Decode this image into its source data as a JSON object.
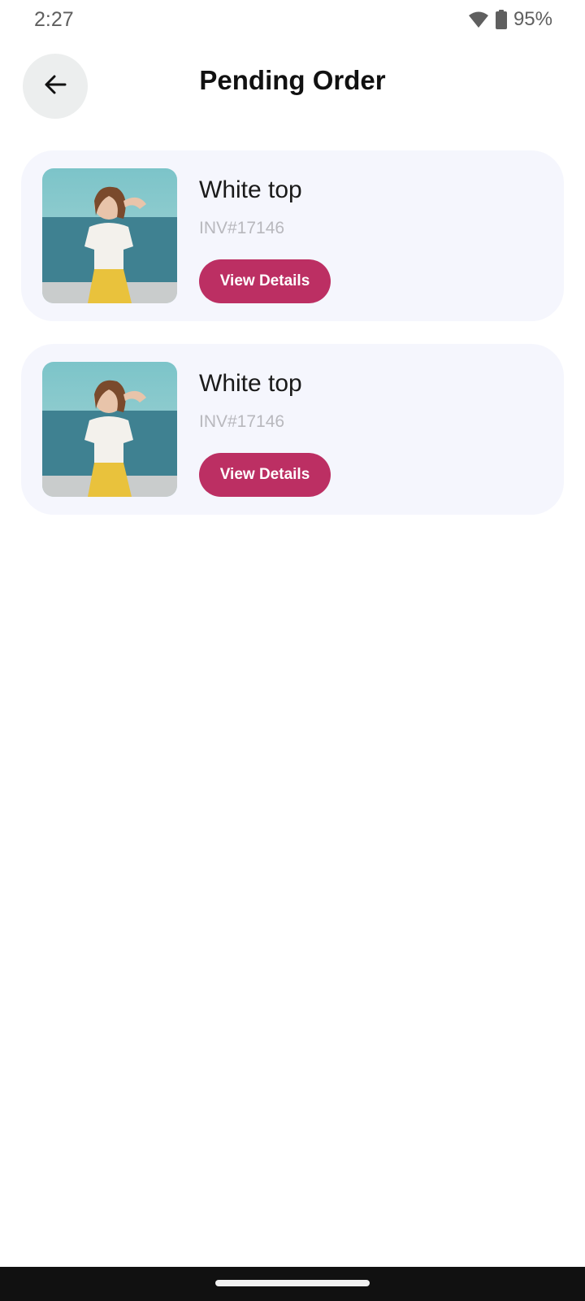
{
  "status_bar": {
    "time": "2:27",
    "battery": "95%",
    "icons": [
      "wifi-icon",
      "battery-icon"
    ]
  },
  "header": {
    "title": "Pending Order",
    "back_icon": "arrow-left-icon"
  },
  "orders": [
    {
      "name": "White top",
      "invoice": "INV#17146",
      "button_label": "View Details"
    },
    {
      "name": "White top",
      "invoice": "INV#17146",
      "button_label": "View Details"
    }
  ],
  "colors": {
    "accent": "#bc2f63",
    "card_background": "#f5f6fd",
    "back_button_background": "#eceeee",
    "invoice_text": "#b8b8bd"
  }
}
